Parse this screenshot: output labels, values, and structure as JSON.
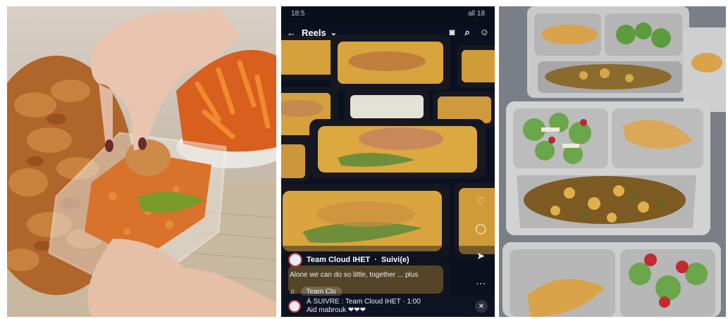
{
  "phone": {
    "status_time": "18:5",
    "status_right": "all 18",
    "top_title": "Reels",
    "account_name": "Team Cloud IHET",
    "follow_label": "Suivi(e)",
    "caption": "Alone we can do so little, together ... plus",
    "audio_label": "Team Clo",
    "banner_line1": "À SUIVRE : Team Cloud IHET · 1:00",
    "banner_line2": "Aid mabrouk ❤❤❤"
  },
  "icons": {
    "back": "arrow-left-icon",
    "camera": "camera-icon",
    "search": "search-icon",
    "profile": "profile-icon",
    "like": "heart-icon",
    "comment": "comment-icon",
    "share": "share-icon",
    "more": "more-icon",
    "close": "close-icon"
  },
  "colors": {
    "phone_bg": "#0a0f1c",
    "rice": "#d7a23a",
    "chicken": "#b8702f",
    "foil": "#c9c9c9",
    "salad_green": "#6aa64a"
  }
}
